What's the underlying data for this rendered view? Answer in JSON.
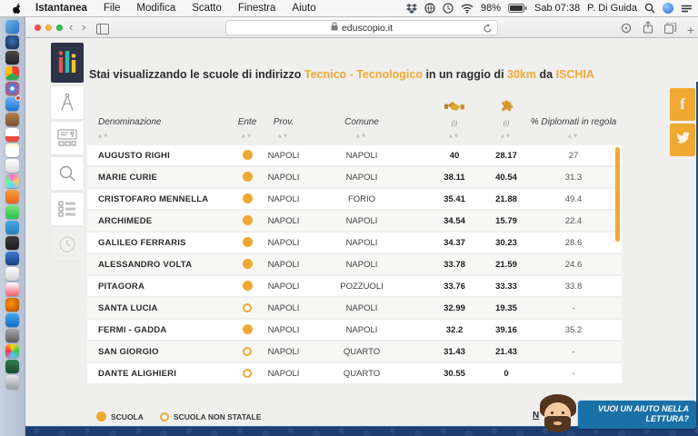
{
  "menubar": {
    "app_name": "Istantanea",
    "menus": [
      "File",
      "Modifica",
      "Scatto",
      "Finestra",
      "Aiuto"
    ],
    "battery_pct": "98%",
    "datetime": "Sab 07:38",
    "account": "P. Di Guida"
  },
  "browser": {
    "address": "eduscopio.it",
    "new_tab_label": "+"
  },
  "header": {
    "t1": "Stai visualizzando le scuole di indirizzo ",
    "t2": "Tecnico - Tecnologico",
    "t3": " in un raggio di ",
    "t4": "30km",
    "t5": " da ",
    "t6": "ISCHIA"
  },
  "social": {
    "facebook_glyph": "f"
  },
  "table": {
    "col_denominazione": "Denominazione",
    "col_ente": "Ente",
    "col_prov": "Prov.",
    "col_comune": "Comune",
    "col_diplomati": "% Diplomati in regola",
    "info": "(i)",
    "sort_glyph": "▲▼",
    "rows": [
      {
        "name": "AUGUSTO RIGHI",
        "statale": true,
        "prov": "NAPOLI",
        "comune": "NAPOLI",
        "indice1": "40",
        "indice2": "28.17",
        "diplomati": "27"
      },
      {
        "name": "MARIE CURIE",
        "statale": true,
        "prov": "NAPOLI",
        "comune": "NAPOLI",
        "indice1": "38.11",
        "indice2": "40.54",
        "diplomati": "31.3"
      },
      {
        "name": "CRISTOFARO MENNELLA",
        "statale": true,
        "prov": "NAPOLI",
        "comune": "FORIO",
        "indice1": "35.41",
        "indice2": "21.88",
        "diplomati": "49.4"
      },
      {
        "name": "ARCHIMEDE",
        "statale": true,
        "prov": "NAPOLI",
        "comune": "NAPOLI",
        "indice1": "34.54",
        "indice2": "15.79",
        "diplomati": "22.4"
      },
      {
        "name": "GALILEO FERRARIS",
        "statale": true,
        "prov": "NAPOLI",
        "comune": "NAPOLI",
        "indice1": "34.37",
        "indice2": "30.23",
        "diplomati": "28.6"
      },
      {
        "name": "ALESSANDRO VOLTA",
        "statale": true,
        "prov": "NAPOLI",
        "comune": "NAPOLI",
        "indice1": "33.78",
        "indice2": "21.59",
        "diplomati": "24.6"
      },
      {
        "name": "PITAGORA",
        "statale": true,
        "prov": "NAPOLI",
        "comune": "POZZUOLI",
        "indice1": "33.76",
        "indice2": "33.33",
        "diplomati": "33.8"
      },
      {
        "name": "SANTA LUCIA",
        "statale": false,
        "prov": "NAPOLI",
        "comune": "NAPOLI",
        "indice1": "32.99",
        "indice2": "19.35",
        "diplomati": "-"
      },
      {
        "name": "FERMI - GADDA",
        "statale": true,
        "prov": "NAPOLI",
        "comune": "NAPOLI",
        "indice1": "32.2",
        "indice2": "39.16",
        "diplomati": "35.2"
      },
      {
        "name": "SAN GIORGIO",
        "statale": false,
        "prov": "NAPOLI",
        "comune": "QUARTO",
        "indice1": "31.43",
        "indice2": "21.43",
        "diplomati": "-"
      },
      {
        "name": "DANTE ALIGHIERI",
        "statale": false,
        "prov": "NAPOLI",
        "comune": "QUARTO",
        "indice1": "30.55",
        "indice2": "0",
        "diplomati": "-"
      }
    ]
  },
  "legend": {
    "scuola": "SCUOLA",
    "non_statale": "SCUOLA NON STATALE"
  },
  "footer": {
    "link_visible": "N",
    "help": "VUOI UN AIUTO NELLA LETTURA?"
  },
  "colors": {
    "accent": "#F0A832",
    "gold_icon": "#D3992F",
    "help_blue": "#1A71A7",
    "band_navy": "#1F3E70",
    "logo_red": "#E2574C",
    "logo_teal": "#2FBDB0",
    "logo_yellow": "#F2C230"
  },
  "dock": {
    "icons": [
      {
        "name": "finder",
        "bg": "linear-gradient(135deg,#6fb6ec,#2a6fc0)"
      },
      {
        "name": "safari",
        "bg": "radial-gradient(circle at 50% 40%,#3f6fae,#16294d)"
      },
      {
        "name": "camera",
        "bg": "linear-gradient(#4a4a4e,#222226)"
      },
      {
        "name": "chrome",
        "bg": "conic-gradient(#ea4335 0 33%,#34a853 33% 66%,#fbbc05 66% 100%)"
      },
      {
        "name": "browser",
        "bg": "radial-gradient(circle at 50% 50%,#fff 20%,#4285f4 22%,#ea4335)"
      },
      {
        "name": "mail",
        "bg": "linear-gradient(#6fb1f5,#1e73d2)",
        "badge": true
      },
      {
        "name": "folder",
        "bg": "linear-gradient(#b08152,#7a5230)"
      },
      {
        "name": "calendar",
        "bg": "linear-gradient(#ffffff 60%,#e74c3c 60%)"
      },
      {
        "name": "notes",
        "bg": "linear-gradient(#fdf6d8 25%,#ffffff 25%)"
      },
      {
        "name": "textedit",
        "bg": "linear-gradient(#ffffff,#d8d8d8)"
      },
      {
        "name": "photos",
        "bg": "conic-gradient(#f6c,#fc6,#6cf,#6f9,#f6c)"
      },
      {
        "name": "preview",
        "bg": "linear-gradient(#f5a03d,#e2641f)"
      },
      {
        "name": "messages",
        "bg": "linear-gradient(#7de381,#2fbf4a)"
      },
      {
        "name": "facetime",
        "bg": "linear-gradient(#4aa8e0,#2a7fc0)"
      },
      {
        "name": "sketch",
        "bg": "linear-gradient(#3a3a3c,#1f1f21)"
      },
      {
        "name": "word",
        "bg": "linear-gradient(#3f7ad1,#1a3f85)"
      },
      {
        "name": "numbers",
        "bg": "linear-gradient(#ffffff,#cfcfcf)"
      },
      {
        "name": "music",
        "bg": "linear-gradient(#ffffff,#f25b6a)"
      },
      {
        "name": "firefox",
        "bg": "radial-gradient(circle at 40% 40%,#ff9500,#b34700)"
      },
      {
        "name": "appstore",
        "bg": "linear-gradient(#4aa3e8,#0f6fc8)"
      },
      {
        "name": "settings",
        "bg": "linear-gradient(#a9a9ae,#5a5a5e)"
      },
      {
        "name": "game-center",
        "bg": "conic-gradient(#ffd60a,#34c759,#5ac8fa,#ff2d55,#ffd60a)"
      },
      {
        "name": "utility",
        "bg": "linear-gradient(#2f7d4f,#174a2c)"
      },
      {
        "name": "trash",
        "bg": "linear-gradient(#e3e7ec,#9aa0a8)"
      }
    ]
  }
}
